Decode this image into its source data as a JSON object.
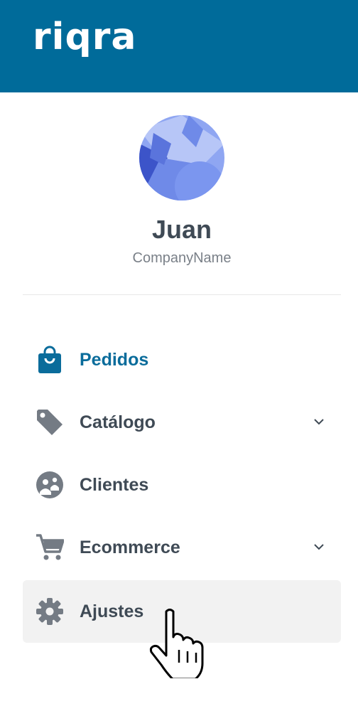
{
  "header": {
    "logo_text": "riqra",
    "color": "#006b9a"
  },
  "profile": {
    "name": "Juan",
    "company": "CompanyName"
  },
  "menu": {
    "items": [
      {
        "label": "Pedidos",
        "icon": "shopping-bag-icon",
        "active": true,
        "expandable": false
      },
      {
        "label": "Catálogo",
        "icon": "tag-icon",
        "active": false,
        "expandable": true
      },
      {
        "label": "Clientes",
        "icon": "clients-icon",
        "active": false,
        "expandable": false
      },
      {
        "label": "Ecommerce",
        "icon": "cart-icon",
        "active": false,
        "expandable": true
      },
      {
        "label": "Ajustes",
        "icon": "gear-icon",
        "active": false,
        "expandable": false,
        "hovered": true
      }
    ]
  },
  "colors": {
    "accent": "#0a6c9b",
    "text": "#3f4a55",
    "icon": "#747b84",
    "hover_bg": "#f2f2f2"
  }
}
